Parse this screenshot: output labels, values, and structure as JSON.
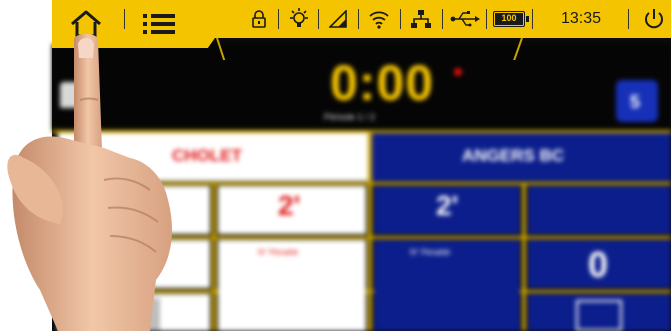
{
  "statusbar": {
    "time": "13:35",
    "battery_label": "100",
    "icons": [
      "lock-icon",
      "brightness-icon",
      "signal-icon",
      "wifi-icon",
      "network-icon",
      "usb-icon",
      "battery-icon",
      "power-icon"
    ],
    "accent_color": "#f5c400"
  },
  "nav": {
    "home_icon": "home-icon",
    "menu_icon": "menu-icon"
  },
  "scoreboard": {
    "clock": "0:00",
    "period": "Période 1 / 2",
    "home_team": "CHOLET",
    "away_team": "ANGERS BC",
    "home_timeouts": "2'",
    "away_timeouts": "2'",
    "away_score": "0",
    "away_shirt_number": "5",
    "home_fouls_label": "N° Pénalité",
    "away_fouls_label": "N° Pénalité",
    "home_color": "#e01818",
    "away_color": "#0c1e8c"
  }
}
